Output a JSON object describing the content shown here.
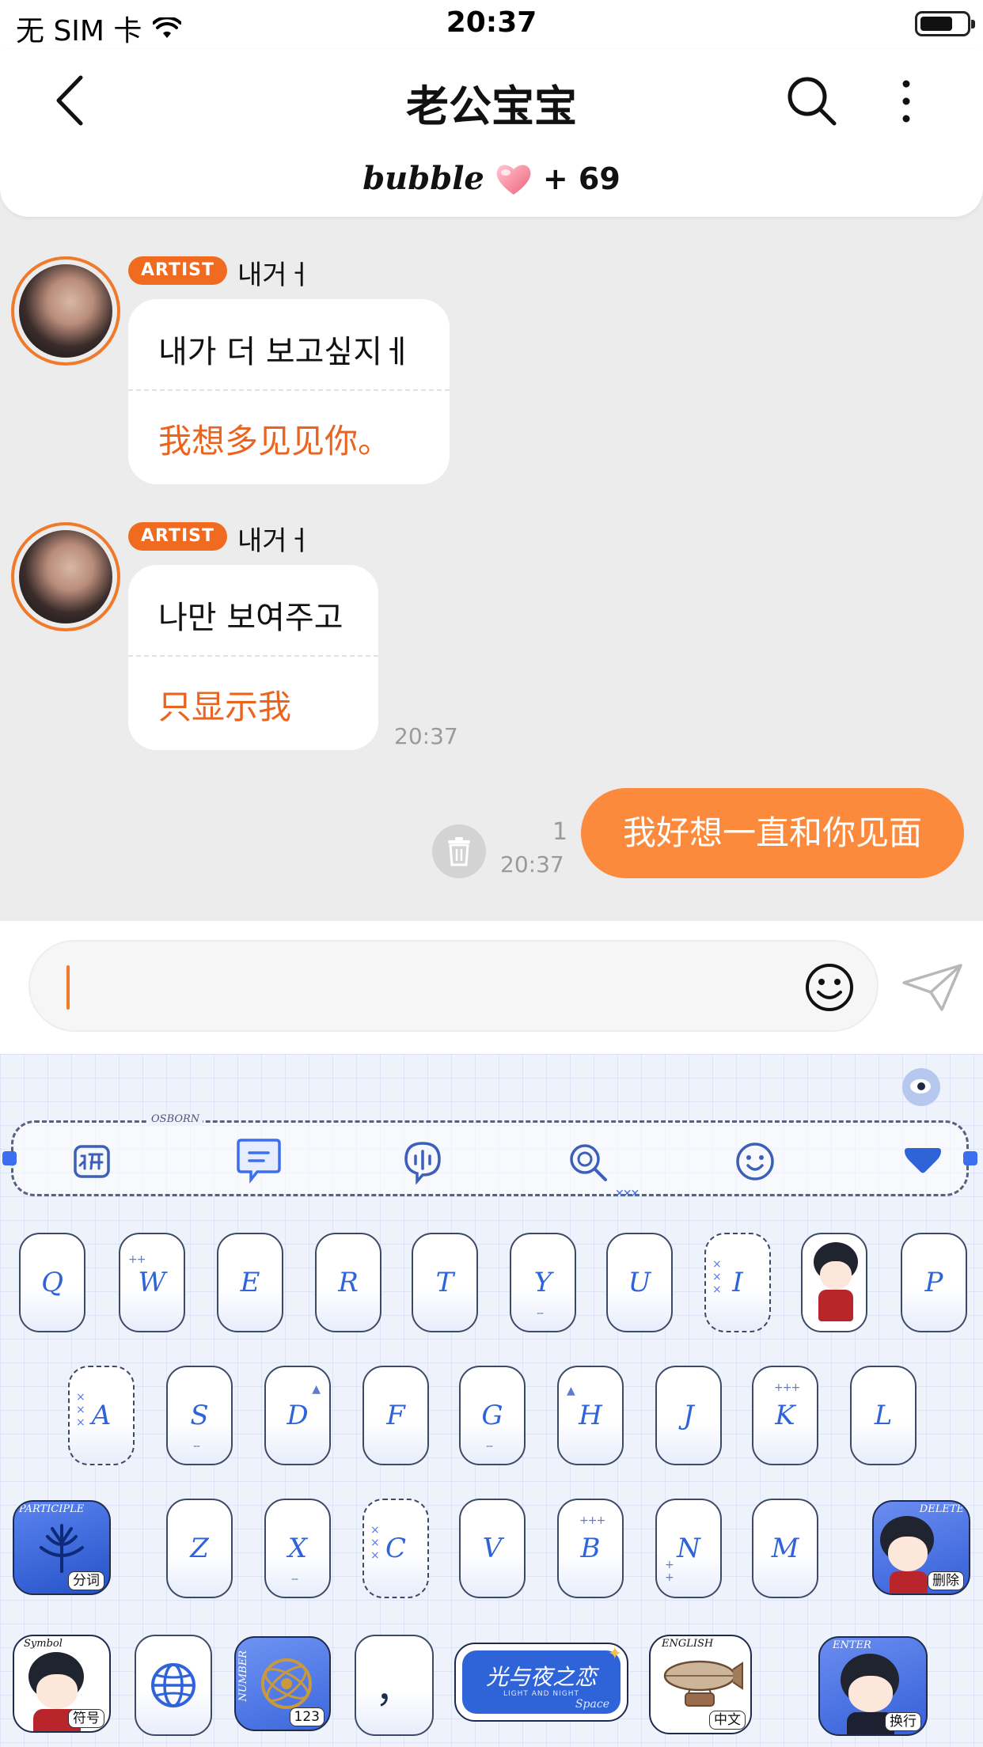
{
  "status_bar": {
    "carrier": "无 SIM 卡",
    "time": "20:37"
  },
  "header": {
    "title": "老公宝宝",
    "bubble_label": "bubble",
    "bubble_count": "+ 69"
  },
  "messages": [
    {
      "badge": "ARTIST",
      "sender": "내거ㅓ",
      "original": "내가 더 보고싶지ㅔ",
      "translation": "我想多见见你。"
    },
    {
      "badge": "ARTIST",
      "sender": "내거ㅓ",
      "original": "나만 보여주고",
      "translation": "只显示我",
      "time": "20:37"
    }
  ],
  "outgoing": {
    "text": "我好想一直和你见面",
    "read_count": "1",
    "time": "20:37"
  },
  "keyboard": {
    "toolbar_tag": "OSBORN",
    "row1": [
      "Q",
      "W",
      "E",
      "R",
      "T",
      "Y",
      "U",
      "I",
      "P"
    ],
    "row2": [
      "A",
      "S",
      "D",
      "F",
      "G",
      "H",
      "J",
      "K",
      "L"
    ],
    "row3": [
      "Z",
      "X",
      "C",
      "V",
      "B",
      "N",
      "M"
    ],
    "participle": {
      "tag": "PARTICIPLE",
      "label": "分词"
    },
    "delete": {
      "tag": "DELETE",
      "label": "删除"
    },
    "symbol": {
      "tag": "Symbol",
      "label": "符号"
    },
    "number": {
      "tag": "NUMBER",
      "label": "123"
    },
    "comma": "，",
    "space": {
      "logo": "光与夜之恋",
      "sub": "LIGHT AND NIGHT",
      "label": "Space"
    },
    "english": {
      "tag": "ENGLISH",
      "label": "中文"
    },
    "enter": {
      "tag": "ENTER",
      "label": "换行"
    }
  },
  "colors": {
    "accent_orange": "#f06b1f",
    "bubble_orange": "#fc8a3d",
    "translation_orange": "#ea6420",
    "keyboard_blue": "#2f63d8"
  }
}
